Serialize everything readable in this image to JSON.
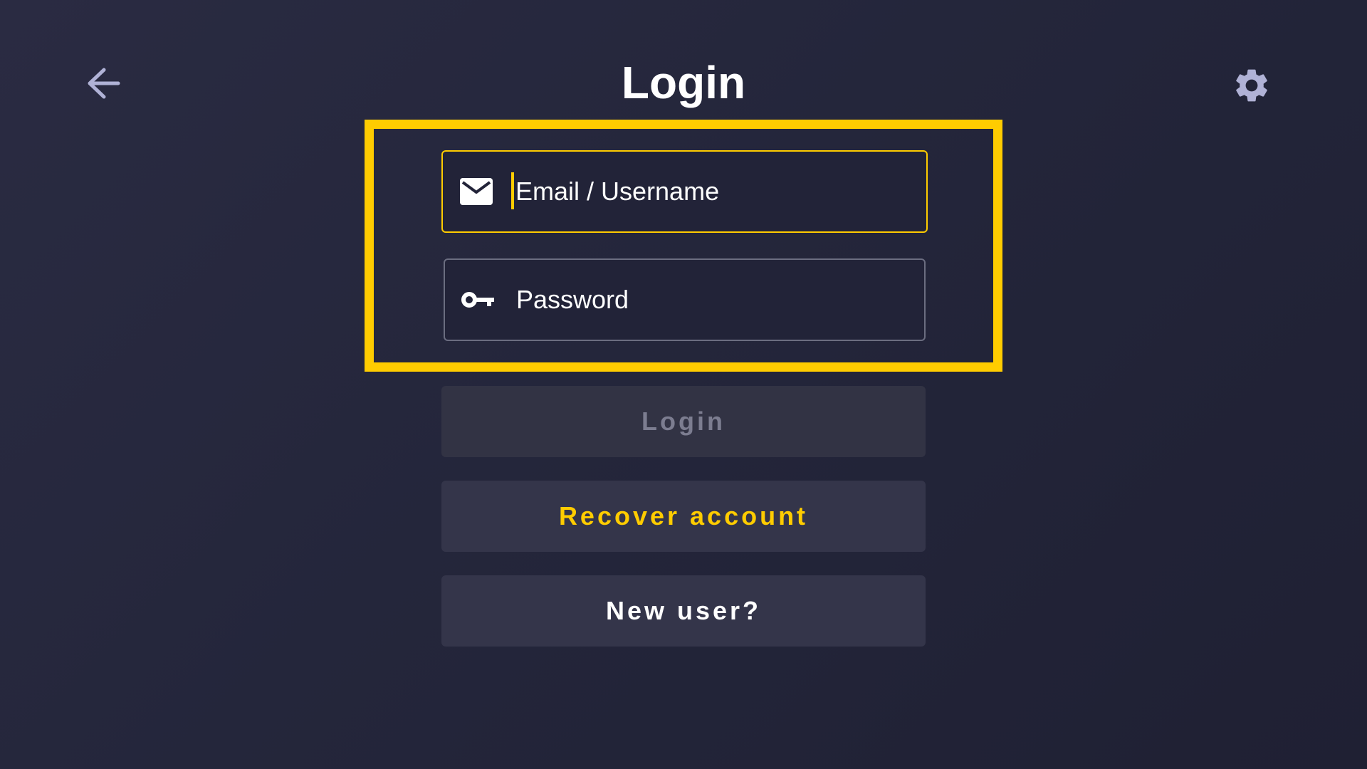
{
  "header": {
    "title": "Login",
    "back_icon": "arrow-left-icon",
    "settings_icon": "gear-icon"
  },
  "form": {
    "email": {
      "icon": "envelope-icon",
      "placeholder": "Email / Username",
      "value": "",
      "focused": true
    },
    "password": {
      "icon": "key-icon",
      "placeholder": "Password",
      "value": ""
    }
  },
  "buttons": {
    "login_label": "Login",
    "login_enabled": false,
    "recover_label": "Recover account",
    "new_user_label": "New user?"
  },
  "colors": {
    "accent": "#ffcc00",
    "background": "#24263b",
    "button": "#34354a",
    "icon_muted": "#b0b2d6"
  }
}
